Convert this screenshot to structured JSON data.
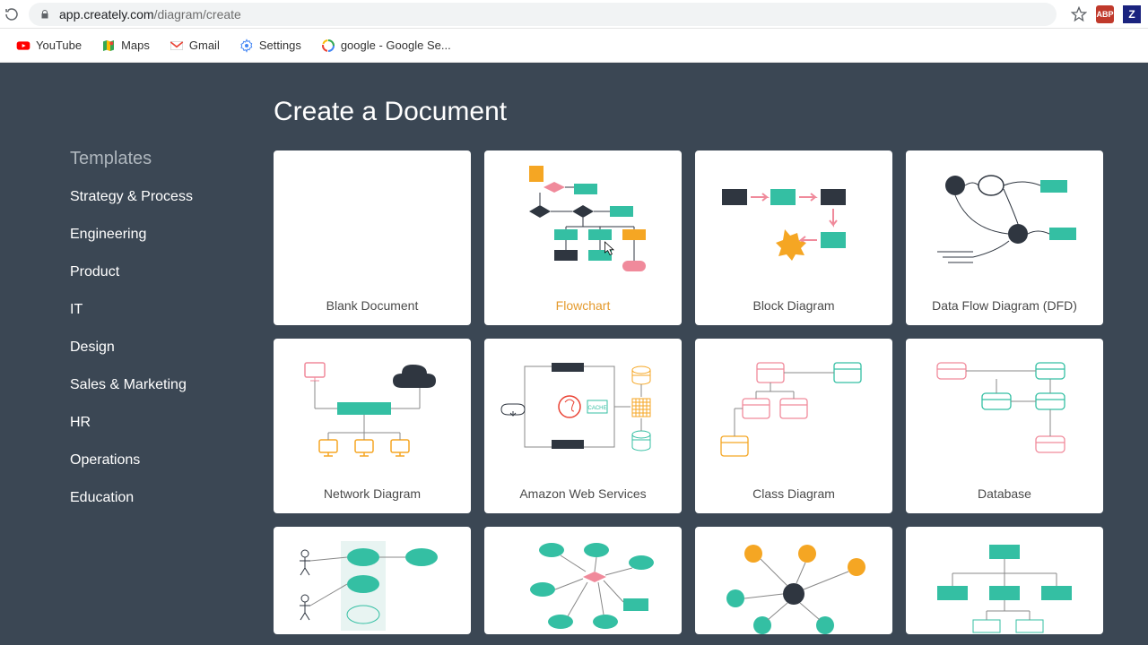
{
  "browser": {
    "url_host": "app.creately.com",
    "url_path": "/diagram/create",
    "ext_abp": "ABP",
    "ext_z": "Z"
  },
  "bookmarks": [
    {
      "label": "YouTube"
    },
    {
      "label": "Maps"
    },
    {
      "label": "Gmail"
    },
    {
      "label": "Settings"
    },
    {
      "label": "google - Google Se..."
    }
  ],
  "sidebar": {
    "title": "Templates",
    "items": [
      "Strategy & Process",
      "Engineering",
      "Product",
      "IT",
      "Design",
      "Sales & Marketing",
      "HR",
      "Operations",
      "Education"
    ]
  },
  "page": {
    "title": "Create a Document"
  },
  "templates": {
    "row1": [
      {
        "label": "Blank Document"
      },
      {
        "label": "Flowchart",
        "highlight": true
      },
      {
        "label": "Block Diagram"
      },
      {
        "label": "Data Flow Diagram (DFD)"
      }
    ],
    "row2": [
      {
        "label": "Network Diagram"
      },
      {
        "label": "Amazon Web Services"
      },
      {
        "label": "Class Diagram"
      },
      {
        "label": "Database"
      }
    ]
  },
  "colors": {
    "teal": "#34bfa3",
    "orange": "#f5a623",
    "pink": "#f08a9b",
    "dark": "#2f3640",
    "bg": "#3b4754"
  }
}
